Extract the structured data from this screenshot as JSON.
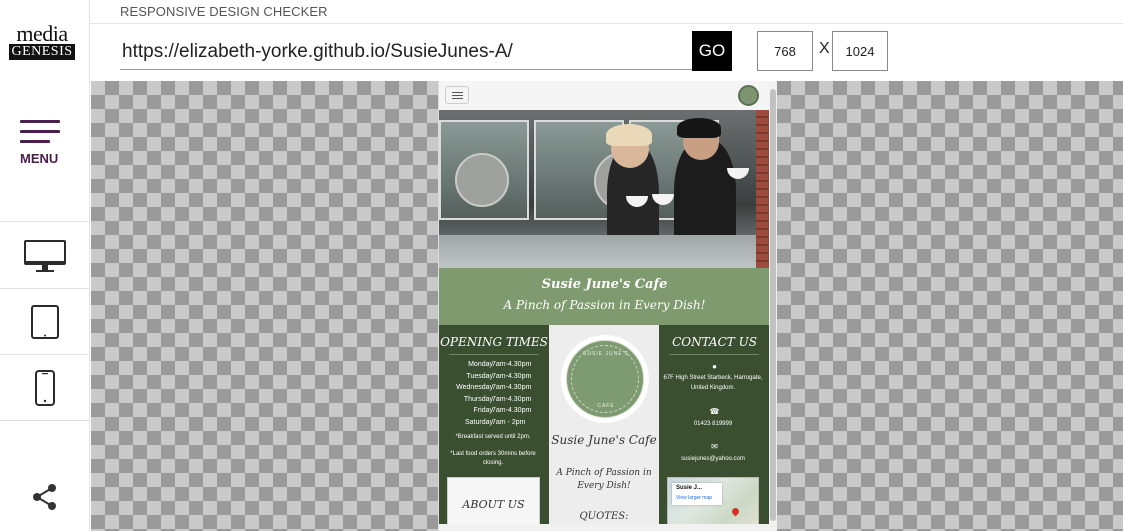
{
  "logo": {
    "top": "media",
    "bottom": "GENESIS"
  },
  "sidebar": {
    "menu_label": "MENU",
    "icons": [
      "desktop-icon",
      "tablet-icon",
      "mobile-icon",
      "share-icon"
    ]
  },
  "toolbar": {
    "title": "RESPONSIVE DESIGN CHECKER",
    "url": "https://elizabeth-yorke.github.io/SusieJunes-A/",
    "go_label": "GO",
    "width": "768",
    "height": "1024",
    "separator": "X"
  },
  "site": {
    "banner_title": "Susie June's Cafe",
    "banner_tagline": "A Pinch of Passion in Every Dish!",
    "opening": {
      "heading": "OPENING TIMES",
      "rows": [
        {
          "day": "Monday",
          "time": "7am-4.30pm"
        },
        {
          "day": "Tuesday",
          "time": "7am-4.30pm"
        },
        {
          "day": "Wednesday",
          "time": "7am-4.30pm"
        },
        {
          "day": "Thursday",
          "time": "7am-4.30pm"
        },
        {
          "day": "Friday",
          "time": "7am-4.30pm"
        },
        {
          "day": "Saturday",
          "time": "7am - 2pm"
        }
      ],
      "note1": "*Breakfast served until 2pm.",
      "note2": "*Last food orders 30mins before closing."
    },
    "about_label": "ABOUT US",
    "logo_ring_top": "SUSIE JUNE'S",
    "logo_ring_bottom": "CAFE",
    "mid_name": "Susie June's Cafe",
    "mid_tagline": "A Pinch of Passion in Every Dish!",
    "quotes_label": "QUOTES:",
    "contact": {
      "heading": "CONTACT US",
      "address": "67F High Street Starbeck, Harrogate, United Kingdom.",
      "phone": "01423 819999",
      "email": "susiejunes@yahoo.com"
    },
    "map": {
      "place": "Susie J...",
      "link": "View larger map"
    }
  },
  "colors": {
    "accent_purple": "#4a1f4f",
    "site_green": "#7f9a6f",
    "site_dark_green": "#3a4f30"
  }
}
